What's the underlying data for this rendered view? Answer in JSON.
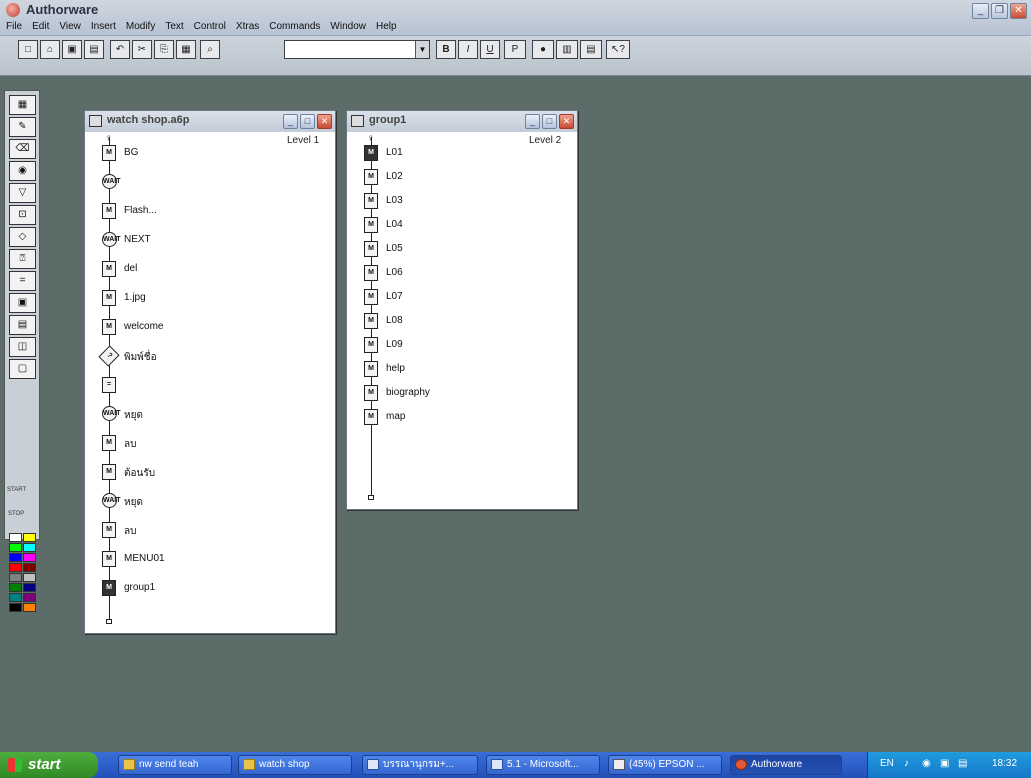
{
  "app": {
    "title": "Authorware"
  },
  "menu": [
    "File",
    "Edit",
    "View",
    "Insert",
    "Modify",
    "Text",
    "Control",
    "Xtras",
    "Commands",
    "Window",
    "Help"
  ],
  "toolbar": {
    "font_combo_value": ""
  },
  "window1": {
    "title": "watch shop.a6p",
    "level": "Level 1",
    "nodes": [
      "BG",
      "",
      "Flash...",
      "NEXT",
      "del",
      "1.jpg",
      "welcome",
      "พิมพ์ชื่อ",
      "",
      "หยุด",
      "ลบ",
      "ต้อนรับ",
      "หยุด",
      "ลบ",
      "MENU01",
      "group1"
    ]
  },
  "window2": {
    "title": "group1",
    "level": "Level 2",
    "nodes": [
      "L01",
      "L02",
      "L03",
      "L04",
      "L05",
      "L06",
      "L07",
      "L08",
      "L09",
      "help",
      "biography",
      "map"
    ]
  },
  "taskbar": {
    "start_label": "start",
    "tasks": [
      "nw send teah",
      "watch shop",
      "บรรณานุกรม+...",
      "5.1 - Microsoft...",
      "(45%) EPSON ...",
      "Authorware"
    ],
    "lang": "EN",
    "clock": "18:32"
  },
  "palette": {
    "start_label": "START",
    "stop_label": "STOP",
    "colors": [
      "#ffffff",
      "#ffff00",
      "#00ff00",
      "#00ffff",
      "#0000ff",
      "#ff00ff",
      "#ff0000",
      "#800000",
      "#808080",
      "#c0c0c0",
      "#008000",
      "#000080",
      "#008080",
      "#800080",
      "#000000",
      "#ff8000"
    ]
  }
}
